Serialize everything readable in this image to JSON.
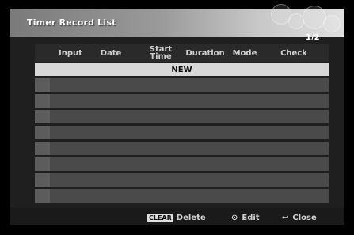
{
  "window": {
    "title": "Timer Record List",
    "page_indicator": "1/2"
  },
  "table": {
    "columns": [
      "Input",
      "Date",
      "Start Time",
      "Duration",
      "Mode",
      "Check"
    ],
    "new_entry_label": "NEW",
    "empty_rows": 9
  },
  "footer": {
    "clear_badge": "CLEAR",
    "delete_label": "Delete",
    "edit_icon": "⊙",
    "edit_label": "Edit",
    "close_icon": "↩",
    "close_label": "Close"
  }
}
